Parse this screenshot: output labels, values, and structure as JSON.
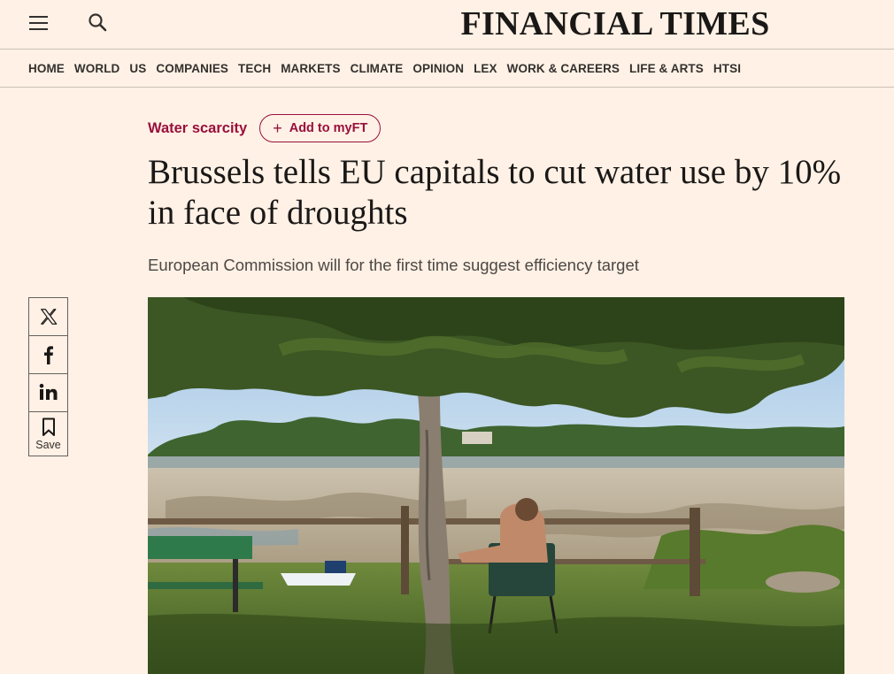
{
  "header": {
    "masthead": "FINANCIAL TIMES",
    "menu_icon": "hamburger-menu-icon",
    "search_icon": "search-icon"
  },
  "nav": {
    "items": [
      "HOME",
      "WORLD",
      "US",
      "COMPANIES",
      "TECH",
      "MARKETS",
      "CLIMATE",
      "OPINION",
      "LEX",
      "WORK & CAREERS",
      "LIFE & ARTS",
      "HTSI"
    ]
  },
  "article": {
    "topic": "Water scarcity",
    "add_myft_label": "Add to myFT",
    "headline": "Brussels tells EU capitals to cut water use by 10% in face of droughts",
    "standfirst": "European Commission will for the first time suggest efficiency target"
  },
  "share": {
    "items": [
      {
        "icon": "x-twitter-icon"
      },
      {
        "icon": "facebook-icon"
      },
      {
        "icon": "linkedin-icon"
      },
      {
        "icon": "bookmark-icon",
        "label": "Save"
      }
    ]
  },
  "colors": {
    "background": "#fff1e5",
    "accent": "#990f3d",
    "text": "#33302e"
  }
}
